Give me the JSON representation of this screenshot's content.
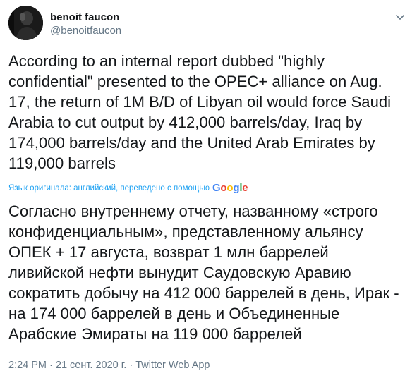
{
  "author": {
    "display_name": "benoit faucon",
    "handle": "@benoitfaucon"
  },
  "tweet": {
    "text": "According to an internal report dubbed \"highly confidential\" presented to the OPEC+ alliance on Aug. 17, the return of 1M B/D of Libyan oil would force Saudi Arabia to cut output by 412,000 barrels/day, Iraq by 174,000 barrels/day and the United Arab Emirates by 119,000 barrels",
    "translation_notice": "Язык оригинала: английский, переведено с помощью",
    "translation_provider": "Google",
    "translated_text": "Согласно внутреннему отчету, названному «строго конфиденциальным», представленному альянсу ОПЕК + 17 августа, возврат 1 млн баррелей ливийской нефти вынудит Саудовскую Аравию сократить добычу на 412 000 баррелей в день, Ирак - на 174 000 баррелей в день и Объединенные Арабские Эмираты на 119 000 баррелей"
  },
  "meta": {
    "time": "2:24 PM",
    "separator": " · ",
    "date": "21 сент. 2020 г.",
    "source": "Twitter Web App"
  },
  "colors": {
    "text": "#14171a",
    "secondary": "#657786",
    "link": "#1da1f2"
  },
  "icons": {
    "caret": "chevron-down-icon"
  }
}
